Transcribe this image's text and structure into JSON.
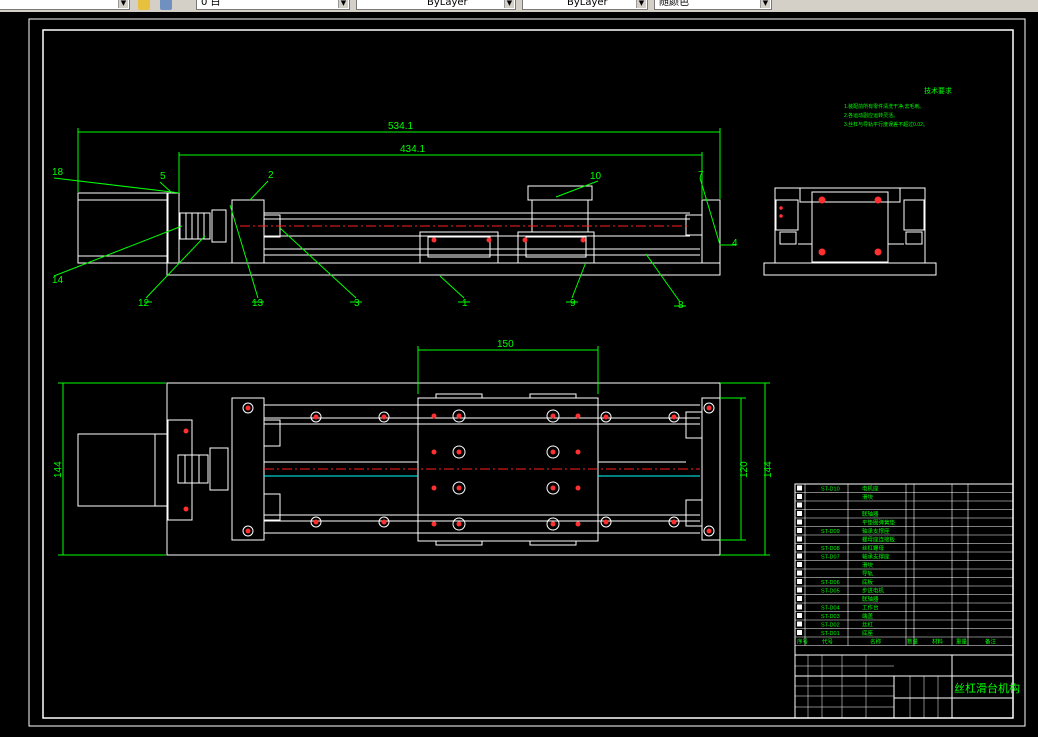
{
  "toolbar": {
    "layer_value": "0 白",
    "color_value": "ByLayer",
    "linetype_value": "ByLayer",
    "lineweight_value": "随颜色"
  },
  "drawing": {
    "top_view": {
      "dim_overall": "534.1",
      "dim_inner": "434.1",
      "callouts": [
        "18",
        "5",
        "2",
        "10",
        "7",
        "4",
        "14",
        "12",
        "13",
        "3",
        "1",
        "9",
        "8"
      ]
    },
    "bottom_view": {
      "dim_width": "150",
      "dim_height_left": "144",
      "dim_height_right_outer": "144",
      "dim_height_right_inner": "120"
    },
    "notes": {
      "title": "技术要求",
      "lines": [
        "1.装配前所有零件清洗干净,去毛刺。",
        "2.各运动副应运转灵活。",
        "3.丝杠与导轨平行度误差不超过0.02。"
      ]
    },
    "title_block": {
      "name": "丝杠滑台机构",
      "parts": [
        {
          "code": "ST-D10",
          "name": "电机座"
        },
        {
          "code": "",
          "name": "滑块"
        },
        {
          "code": "",
          "name": ""
        },
        {
          "code": "",
          "name": "联轴器"
        },
        {
          "code": "",
          "name": "平垫圈弹簧垫"
        },
        {
          "code": "ST-D09",
          "name": "轴承支撑座"
        },
        {
          "code": "",
          "name": "螺母座连接板"
        },
        {
          "code": "ST-D08",
          "name": "丝杠螺母"
        },
        {
          "code": "ST-D07",
          "name": "轴承支撑座"
        },
        {
          "code": "",
          "name": "滑块"
        },
        {
          "code": "",
          "name": "导轨"
        },
        {
          "code": "ST-D06",
          "name": "底板"
        },
        {
          "code": "ST-D05",
          "name": "步进电机"
        },
        {
          "code": "",
          "name": "联轴器"
        },
        {
          "code": "ST-D04",
          "name": "工作台"
        },
        {
          "code": "ST-D03",
          "name": "端盖"
        },
        {
          "code": "ST-D02",
          "name": "丝杠"
        },
        {
          "code": "ST-D01",
          "name": "底座"
        }
      ],
      "header": {
        "seq": "序号",
        "code": "代号",
        "name": "名称",
        "qty": "数量",
        "material": "材料",
        "weight": "重量",
        "remark": "备注"
      }
    }
  },
  "colors": {
    "background": "#000000",
    "line": "#ffffff",
    "dimension": "#00ff00",
    "centerline": "#ff2020",
    "hidden": "#00ffff",
    "hole": "#ff3030"
  }
}
